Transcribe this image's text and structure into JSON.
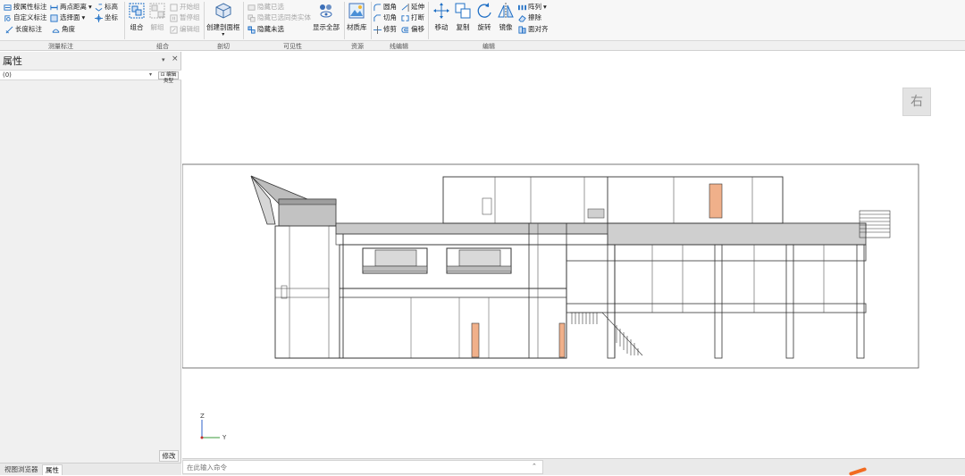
{
  "ribbon": {
    "measure": {
      "attr_dim": "按属性标注",
      "two_point": "两点距离",
      "elevation": "标高",
      "custom_dim": "自定义标注",
      "select_face": "选择面",
      "coordinate": "坐标",
      "length_dim": "长度标注",
      "angle": "角度"
    },
    "group": {
      "combine": "组合",
      "ungroup": "解组",
      "open_group": "开始组",
      "pause_group": "暂停组",
      "edit_group": "编辑组"
    },
    "section": {
      "create_box": "创建剖面框"
    },
    "visibility": {
      "hide_selected": "隐藏已选",
      "hide_selected_same": "隐藏已选同类实体",
      "hide_unselected": "隐藏未选",
      "show_all": "显示全部"
    },
    "resource": {
      "material_lib": "材质库"
    },
    "line_edit": {
      "fillet": "圆角",
      "extend": "延伸",
      "chamfer": "切角",
      "break": "打断",
      "trim": "修剪",
      "offset": "偏移"
    },
    "edit": {
      "move": "移动",
      "copy": "复制",
      "rotate": "旋转",
      "mirror": "镜像",
      "array": "阵列",
      "delete": "擦除",
      "align": "面对齐"
    },
    "group_labels": {
      "measure": "测量标注",
      "group": "组合",
      "section": "剖切",
      "visibility": "可见性",
      "resource": "资源",
      "line_edit": "线编辑",
      "edit": "编辑"
    }
  },
  "properties_panel": {
    "title": "属性",
    "pin": "▾",
    "close": "×",
    "selector_value": "(0)",
    "edit_type_label": "⊡ 编辑类型",
    "apply_label": "修改"
  },
  "bottom_tabs": [
    {
      "label": "视图浏览器"
    },
    {
      "label": "属性"
    }
  ],
  "viewport": {
    "viewcube_label": "右",
    "axis_z": "Z",
    "axis_y": "Y"
  },
  "command": {
    "placeholder": "在此输入命令",
    "toggle": "⌃"
  },
  "colors": {
    "accent": "#1f6fc5",
    "door_fill": "#f0b08a",
    "roof_fill": "#c8c8c8",
    "axis_green": "#3a9a3a",
    "axis_blue": "#2e62c9"
  }
}
